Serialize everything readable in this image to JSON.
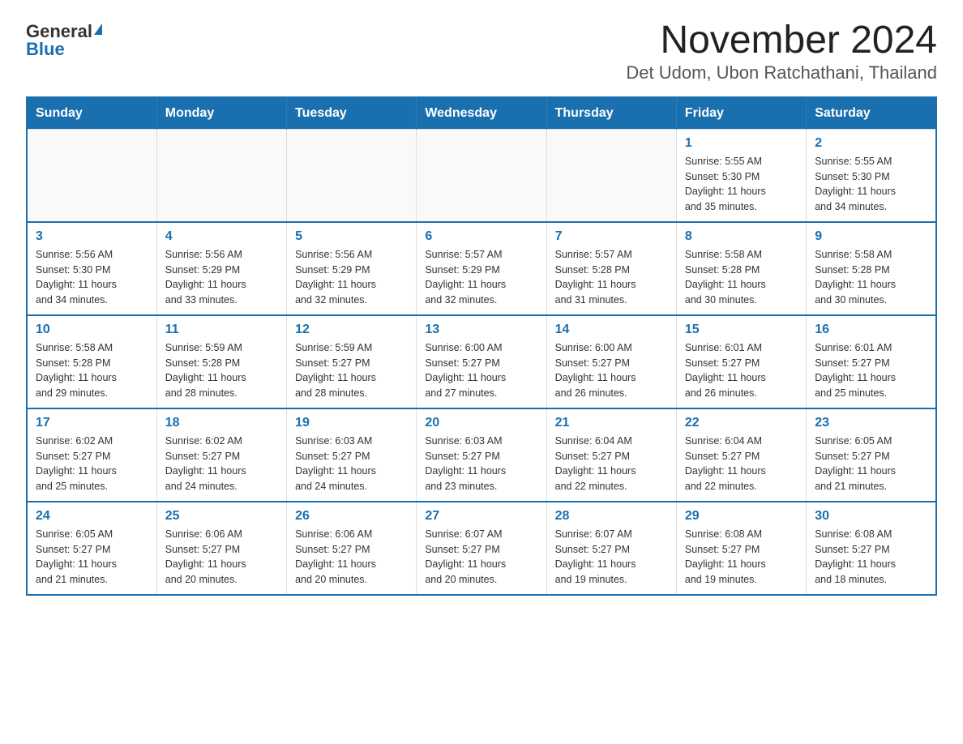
{
  "header": {
    "logo_general": "General",
    "logo_blue": "Blue",
    "title": "November 2024",
    "subtitle": "Det Udom, Ubon Ratchathani, Thailand"
  },
  "weekdays": [
    "Sunday",
    "Monday",
    "Tuesday",
    "Wednesday",
    "Thursday",
    "Friday",
    "Saturday"
  ],
  "weeks": [
    [
      {
        "day": "",
        "info": ""
      },
      {
        "day": "",
        "info": ""
      },
      {
        "day": "",
        "info": ""
      },
      {
        "day": "",
        "info": ""
      },
      {
        "day": "",
        "info": ""
      },
      {
        "day": "1",
        "info": "Sunrise: 5:55 AM\nSunset: 5:30 PM\nDaylight: 11 hours\nand 35 minutes."
      },
      {
        "day": "2",
        "info": "Sunrise: 5:55 AM\nSunset: 5:30 PM\nDaylight: 11 hours\nand 34 minutes."
      }
    ],
    [
      {
        "day": "3",
        "info": "Sunrise: 5:56 AM\nSunset: 5:30 PM\nDaylight: 11 hours\nand 34 minutes."
      },
      {
        "day": "4",
        "info": "Sunrise: 5:56 AM\nSunset: 5:29 PM\nDaylight: 11 hours\nand 33 minutes."
      },
      {
        "day": "5",
        "info": "Sunrise: 5:56 AM\nSunset: 5:29 PM\nDaylight: 11 hours\nand 32 minutes."
      },
      {
        "day": "6",
        "info": "Sunrise: 5:57 AM\nSunset: 5:29 PM\nDaylight: 11 hours\nand 32 minutes."
      },
      {
        "day": "7",
        "info": "Sunrise: 5:57 AM\nSunset: 5:28 PM\nDaylight: 11 hours\nand 31 minutes."
      },
      {
        "day": "8",
        "info": "Sunrise: 5:58 AM\nSunset: 5:28 PM\nDaylight: 11 hours\nand 30 minutes."
      },
      {
        "day": "9",
        "info": "Sunrise: 5:58 AM\nSunset: 5:28 PM\nDaylight: 11 hours\nand 30 minutes."
      }
    ],
    [
      {
        "day": "10",
        "info": "Sunrise: 5:58 AM\nSunset: 5:28 PM\nDaylight: 11 hours\nand 29 minutes."
      },
      {
        "day": "11",
        "info": "Sunrise: 5:59 AM\nSunset: 5:28 PM\nDaylight: 11 hours\nand 28 minutes."
      },
      {
        "day": "12",
        "info": "Sunrise: 5:59 AM\nSunset: 5:27 PM\nDaylight: 11 hours\nand 28 minutes."
      },
      {
        "day": "13",
        "info": "Sunrise: 6:00 AM\nSunset: 5:27 PM\nDaylight: 11 hours\nand 27 minutes."
      },
      {
        "day": "14",
        "info": "Sunrise: 6:00 AM\nSunset: 5:27 PM\nDaylight: 11 hours\nand 26 minutes."
      },
      {
        "day": "15",
        "info": "Sunrise: 6:01 AM\nSunset: 5:27 PM\nDaylight: 11 hours\nand 26 minutes."
      },
      {
        "day": "16",
        "info": "Sunrise: 6:01 AM\nSunset: 5:27 PM\nDaylight: 11 hours\nand 25 minutes."
      }
    ],
    [
      {
        "day": "17",
        "info": "Sunrise: 6:02 AM\nSunset: 5:27 PM\nDaylight: 11 hours\nand 25 minutes."
      },
      {
        "day": "18",
        "info": "Sunrise: 6:02 AM\nSunset: 5:27 PM\nDaylight: 11 hours\nand 24 minutes."
      },
      {
        "day": "19",
        "info": "Sunrise: 6:03 AM\nSunset: 5:27 PM\nDaylight: 11 hours\nand 24 minutes."
      },
      {
        "day": "20",
        "info": "Sunrise: 6:03 AM\nSunset: 5:27 PM\nDaylight: 11 hours\nand 23 minutes."
      },
      {
        "day": "21",
        "info": "Sunrise: 6:04 AM\nSunset: 5:27 PM\nDaylight: 11 hours\nand 22 minutes."
      },
      {
        "day": "22",
        "info": "Sunrise: 6:04 AM\nSunset: 5:27 PM\nDaylight: 11 hours\nand 22 minutes."
      },
      {
        "day": "23",
        "info": "Sunrise: 6:05 AM\nSunset: 5:27 PM\nDaylight: 11 hours\nand 21 minutes."
      }
    ],
    [
      {
        "day": "24",
        "info": "Sunrise: 6:05 AM\nSunset: 5:27 PM\nDaylight: 11 hours\nand 21 minutes."
      },
      {
        "day": "25",
        "info": "Sunrise: 6:06 AM\nSunset: 5:27 PM\nDaylight: 11 hours\nand 20 minutes."
      },
      {
        "day": "26",
        "info": "Sunrise: 6:06 AM\nSunset: 5:27 PM\nDaylight: 11 hours\nand 20 minutes."
      },
      {
        "day": "27",
        "info": "Sunrise: 6:07 AM\nSunset: 5:27 PM\nDaylight: 11 hours\nand 20 minutes."
      },
      {
        "day": "28",
        "info": "Sunrise: 6:07 AM\nSunset: 5:27 PM\nDaylight: 11 hours\nand 19 minutes."
      },
      {
        "day": "29",
        "info": "Sunrise: 6:08 AM\nSunset: 5:27 PM\nDaylight: 11 hours\nand 19 minutes."
      },
      {
        "day": "30",
        "info": "Sunrise: 6:08 AM\nSunset: 5:27 PM\nDaylight: 11 hours\nand 18 minutes."
      }
    ]
  ]
}
